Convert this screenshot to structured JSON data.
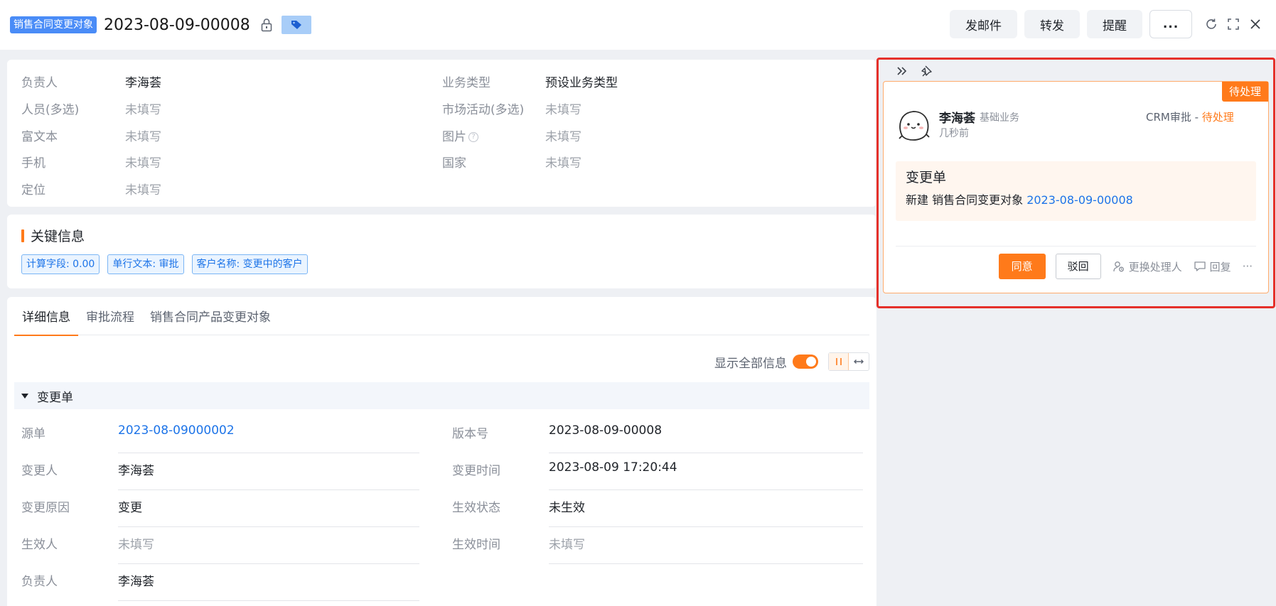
{
  "header": {
    "type_tag": "销售合同变更对象",
    "record_no": "2023-08-09-00008",
    "actions": {
      "email": "发邮件",
      "forward": "转发",
      "remind": "提醒",
      "more": "..."
    }
  },
  "summary": {
    "fields": [
      {
        "label": "负责人",
        "value": "李海荟"
      },
      {
        "label": "人员(多选)",
        "value": "未填写"
      },
      {
        "label": "富文本",
        "value": "未填写"
      },
      {
        "label": "手机",
        "value": "未填写"
      },
      {
        "label": "定位",
        "value": "未填写"
      },
      {
        "label": "业务类型",
        "value": "预设业务类型"
      },
      {
        "label": "市场活动(多选)",
        "value": "未填写"
      },
      {
        "label": "图片",
        "value": "未填写"
      },
      {
        "label": "国家",
        "value": "未填写"
      }
    ]
  },
  "key_info": {
    "title": "关键信息",
    "tags": [
      "计算字段: 0.00",
      "单行文本: 审批",
      "客户名称: 变更中的客户"
    ]
  },
  "detail": {
    "tabs": [
      "详细信息",
      "审批流程",
      "销售合同产品变更对象"
    ],
    "show_all_label": "显示全部信息",
    "group_title": "变更单",
    "rows": [
      {
        "label": "源单",
        "value": "2023-08-09000002"
      },
      {
        "label": "版本号",
        "value": "2023-08-09-00008"
      },
      {
        "label": "变更人",
        "value": "李海荟"
      },
      {
        "label": "变更时间",
        "value": "2023-08-09 17:20:44"
      },
      {
        "label": "变更原因",
        "value": "变更"
      },
      {
        "label": "生效状态",
        "value": "未生效"
      },
      {
        "label": "生效人",
        "value": "未填写"
      },
      {
        "label": "生效时间",
        "value": "未填写"
      },
      {
        "label": "负责人",
        "value": "李海荟"
      }
    ]
  },
  "approval": {
    "badge": "待处理",
    "name": "李海荟",
    "dept": "基础业务",
    "time": "几秒前",
    "flow": "CRM审批 - ",
    "status": "待处理",
    "body_title": "变更单",
    "body_prefix": "新建 销售合同变更对象 ",
    "body_link": "2023-08-09-00008",
    "agree": "同意",
    "reject": "驳回",
    "change_handler": "更换处理人",
    "reply": "回复",
    "more": "···"
  },
  "colors": {
    "accent": "#ff7a1a",
    "link": "#1d74e8",
    "highlight": "#e5302a"
  }
}
